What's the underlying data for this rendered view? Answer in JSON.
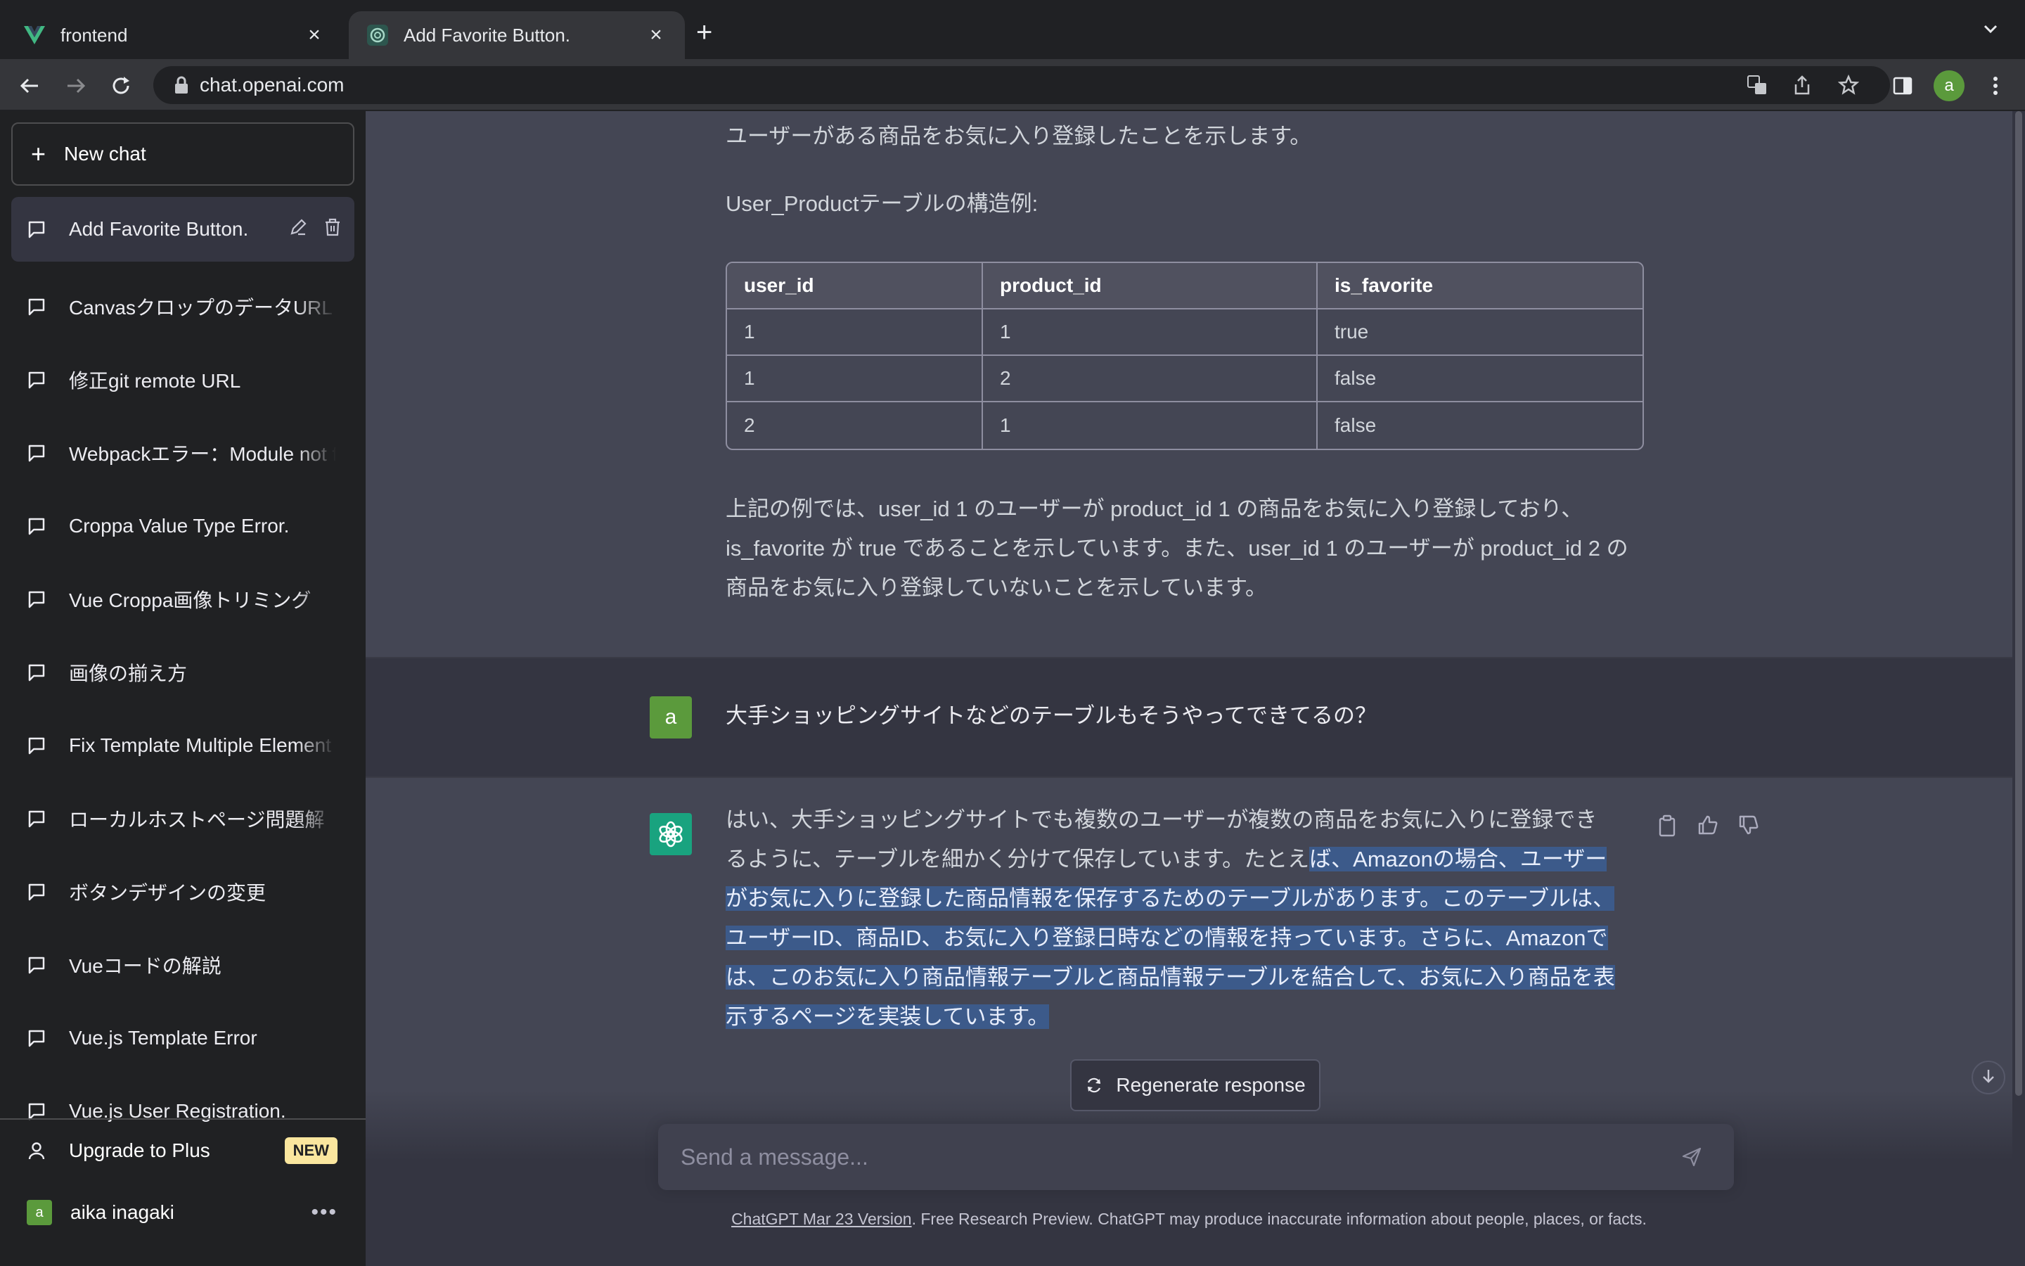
{
  "browser": {
    "tabs": [
      {
        "title": "frontend"
      },
      {
        "title": "Add Favorite Button."
      }
    ],
    "url": "chat.openai.com",
    "profile_initial": "a"
  },
  "sidebar": {
    "new_chat_label": "New chat",
    "chats": [
      "Add Favorite Button.",
      "CanvasクロップのデータURL",
      "修正git remote URL",
      "Webpackエラー：Module not f",
      "Croppa Value Type Error.",
      "Vue Croppa画像トリミング",
      "画像の揃え方",
      "Fix Template Multiple Element",
      "ローカルホストページ問題解",
      "ボタンデザインの変更",
      "Vueコードの解説",
      "Vue.js Template Error",
      "Vue.js User Registration."
    ],
    "upgrade_label": "Upgrade to Plus",
    "new_badge": "NEW",
    "user_initial": "a",
    "user_name": "aika inagaki"
  },
  "conversation": {
    "a1_line1": "ユーザーがある商品をお気に入り登録したことを示します。",
    "a1_line2": "User_Productテーブルの構造例:",
    "table": {
      "headers": [
        "user_id",
        "product_id",
        "is_favorite"
      ],
      "rows": [
        [
          "1",
          "1",
          "true"
        ],
        [
          "1",
          "2",
          "false"
        ],
        [
          "2",
          "1",
          "false"
        ]
      ]
    },
    "a1_para_line1": "上記の例では、user_id 1 のユーザーが product_id 1 の商品をお気に入り登録しており、",
    "a1_para_line2": "is_favorite が true であることを示しています。また、user_id 1 のユーザーが product_id 2 の",
    "a1_para_line3": "商品をお気に入り登録していないことを示しています。",
    "user_initial": "a",
    "user_msg": "大手ショッピングサイトなどのテーブルもそうやってできてるの？",
    "a2_l1": "はい、大手ショッピングサイトでも複数のユーザーが複数の商品をお気に入りに登録でき",
    "a2_l2a": "るように、テーブルを細かく分けて保存しています。たとえ",
    "a2_l2b": "ば、Amazonの場合、ユーザー",
    "a2_l3": "がお気に入りに登録した商品情報を保存するためのテーブルがあります。このテーブルは、",
    "a2_l4": "ユーザーID、商品ID、お気に入り登録日時などの情報を持っています。さらに、Amazonで",
    "a2_l5": "は、このお気に入り商品情報テーブルと商品情報テーブルを結合して、お気に入り商品を表",
    "a2_l6": "示するページを実装しています。"
  },
  "regenerate_label": "Regenerate response",
  "composer": {
    "placeholder": "Send a message..."
  },
  "footer": {
    "link": "ChatGPT Mar 23 Version",
    "text": ". Free Research Preview. ChatGPT may produce inaccurate information about people, places, or facts."
  },
  "colors": {
    "accent_green": "#19a37f",
    "user_avatar": "#5b9a3c",
    "selection": "#3c5a8a"
  }
}
